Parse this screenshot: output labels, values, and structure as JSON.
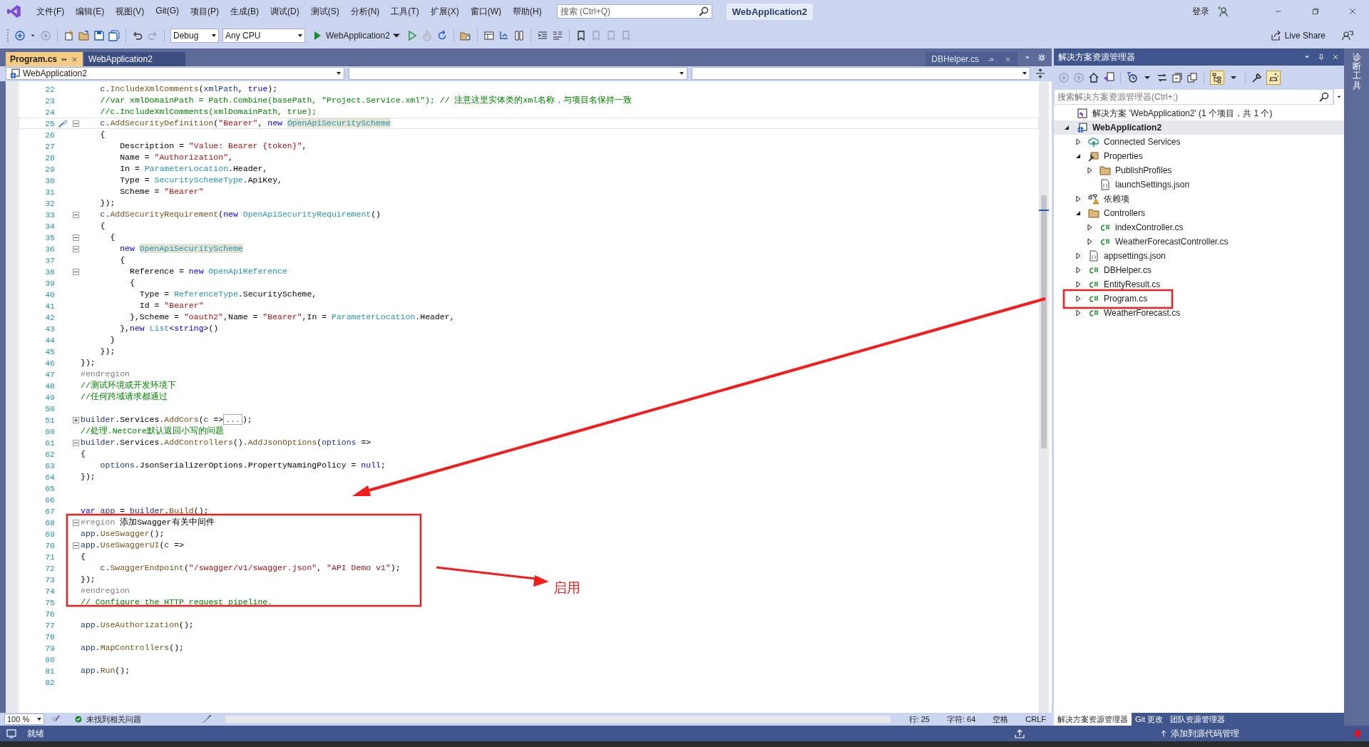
{
  "menu": [
    "文件(F)",
    "编辑(E)",
    "视图(V)",
    "Git(G)",
    "项目(P)",
    "生成(B)",
    "调试(D)",
    "测试(S)",
    "分析(N)",
    "工具(T)",
    "扩展(X)",
    "窗口(W)",
    "帮助(H)"
  ],
  "search": {
    "placeholder": "搜索 (Ctrl+Q)"
  },
  "title": "WebApplication2",
  "account": "登录",
  "toolbar": {
    "configuration": "Debug",
    "platform": "Any CPU",
    "run_target": "WebApplication2",
    "live_share": "Live Share"
  },
  "doc_tabs": [
    {
      "label": "Program.cs",
      "selected": true
    },
    {
      "label": "WebApplication2",
      "selected": false
    }
  ],
  "preview_tab": {
    "label": "DBHelper.cs"
  },
  "nav_bar": {
    "project": "WebApplication2"
  },
  "code_lines": [
    {
      "n": "22",
      "segs": [
        {
          "kind": "vr",
          "text": "    c"
        },
        {
          "kind": "pl",
          "text": "."
        },
        {
          "kind": "mt",
          "text": "IncludeXmlComments"
        },
        {
          "kind": "pl",
          "text": "("
        },
        {
          "kind": "vr",
          "text": "xmlPath"
        },
        {
          "kind": "pl",
          "text": ", "
        },
        {
          "kind": "kw",
          "text": "true"
        },
        {
          "kind": "pl",
          "text": ");"
        }
      ]
    },
    {
      "n": "23",
      "segs": [
        {
          "kind": "cm",
          "text": "    //var xmlDomainPath = Path.Combine(basePath, \"Project.Service.xml\"); // 注意这里实体类的xml名称，与项目名保持一致"
        }
      ]
    },
    {
      "n": "24",
      "segs": [
        {
          "kind": "cm",
          "text": "    //c.IncludeXmlComments(xmlDomainPath, true);"
        }
      ]
    },
    {
      "n": "25",
      "collapsed": false,
      "quick_action": true,
      "current": true,
      "segs": [
        {
          "kind": "vr",
          "text": "    c"
        },
        {
          "kind": "pl",
          "text": "."
        },
        {
          "kind": "mt",
          "text": "AddSecurityDefinition"
        },
        {
          "kind": "pl",
          "text": "("
        },
        {
          "kind": "st",
          "text": "\"Bearer\""
        },
        {
          "kind": "pl",
          "text": ", "
        },
        {
          "kind": "kw",
          "text": "new "
        },
        {
          "kind": "hl",
          "text": "OpenApiSecurityScheme"
        }
      ]
    },
    {
      "n": "26",
      "segs": [
        {
          "kind": "pl",
          "text": "    {"
        }
      ]
    },
    {
      "n": "27",
      "segs": [
        {
          "kind": "pl",
          "text": "        Description = "
        },
        {
          "kind": "st",
          "text": "\"Value: Bearer {token}\""
        },
        {
          "kind": "pl",
          "text": ","
        }
      ]
    },
    {
      "n": "28",
      "segs": [
        {
          "kind": "pl",
          "text": "        Name = "
        },
        {
          "kind": "st",
          "text": "\"Authorization\""
        },
        {
          "kind": "pl",
          "text": ","
        }
      ]
    },
    {
      "n": "29",
      "segs": [
        {
          "kind": "pl",
          "text": "        In = "
        },
        {
          "kind": "ty",
          "text": "ParameterLocation"
        },
        {
          "kind": "pl",
          "text": ".Header,"
        }
      ]
    },
    {
      "n": "30",
      "segs": [
        {
          "kind": "pl",
          "text": "        Type = "
        },
        {
          "kind": "ty",
          "text": "SecuritySchemeType"
        },
        {
          "kind": "pl",
          "text": ".ApiKey,"
        }
      ]
    },
    {
      "n": "31",
      "segs": [
        {
          "kind": "pl",
          "text": "        Scheme = "
        },
        {
          "kind": "st",
          "text": "\"Bearer\""
        }
      ]
    },
    {
      "n": "32",
      "segs": [
        {
          "kind": "pl",
          "text": "    });"
        }
      ]
    },
    {
      "n": "33",
      "collapsed": false,
      "segs": [
        {
          "kind": "vr",
          "text": "    c"
        },
        {
          "kind": "pl",
          "text": "."
        },
        {
          "kind": "mt",
          "text": "AddSecurityRequirement"
        },
        {
          "kind": "pl",
          "text": "("
        },
        {
          "kind": "kw",
          "text": "new "
        },
        {
          "kind": "ty",
          "text": "OpenApiSecurityRequirement"
        },
        {
          "kind": "pl",
          "text": "()"
        }
      ]
    },
    {
      "n": "34",
      "segs": [
        {
          "kind": "pl",
          "text": "    {"
        }
      ]
    },
    {
      "n": "35",
      "collapsed": false,
      "segs": [
        {
          "kind": "pl",
          "text": "      {"
        }
      ]
    },
    {
      "n": "36",
      "collapsed": false,
      "segs": [
        {
          "kind": "kw",
          "text": "        new "
        },
        {
          "kind": "hl",
          "text": "OpenApiSecurityScheme"
        }
      ]
    },
    {
      "n": "37",
      "segs": [
        {
          "kind": "pl",
          "text": "        {"
        }
      ]
    },
    {
      "n": "38",
      "collapsed": false,
      "segs": [
        {
          "kind": "pl",
          "text": "          Reference = "
        },
        {
          "kind": "kw",
          "text": "new "
        },
        {
          "kind": "ty",
          "text": "OpenApiReference"
        }
      ]
    },
    {
      "n": "39",
      "segs": [
        {
          "kind": "pl",
          "text": "          {"
        }
      ]
    },
    {
      "n": "40",
      "segs": [
        {
          "kind": "pl",
          "text": "            Type = "
        },
        {
          "kind": "ty",
          "text": "ReferenceType"
        },
        {
          "kind": "pl",
          "text": ".SecurityScheme,"
        }
      ]
    },
    {
      "n": "41",
      "segs": [
        {
          "kind": "pl",
          "text": "            Id = "
        },
        {
          "kind": "st",
          "text": "\"Bearer\""
        }
      ]
    },
    {
      "n": "42",
      "segs": [
        {
          "kind": "pl",
          "text": "          },Scheme = "
        },
        {
          "kind": "st",
          "text": "\"oauth2\""
        },
        {
          "kind": "pl",
          "text": ",Name = "
        },
        {
          "kind": "st",
          "text": "\"Bearer\""
        },
        {
          "kind": "pl",
          "text": ",In = "
        },
        {
          "kind": "ty",
          "text": "ParameterLocation"
        },
        {
          "kind": "pl",
          "text": ".Header,"
        }
      ]
    },
    {
      "n": "43",
      "segs": [
        {
          "kind": "pl",
          "text": "        },"
        },
        {
          "kind": "kw",
          "text": "new "
        },
        {
          "kind": "ty",
          "text": "List"
        },
        {
          "kind": "pl",
          "text": "<"
        },
        {
          "kind": "kw",
          "text": "string"
        },
        {
          "kind": "pl",
          "text": ">()"
        }
      ]
    },
    {
      "n": "44",
      "segs": [
        {
          "kind": "pl",
          "text": "      }"
        }
      ]
    },
    {
      "n": "45",
      "segs": [
        {
          "kind": "pl",
          "text": "    });"
        }
      ]
    },
    {
      "n": "46",
      "segs": [
        {
          "kind": "pl",
          "text": "});"
        }
      ]
    },
    {
      "n": "47",
      "segs": [
        {
          "kind": "rg",
          "text": "#endregion"
        }
      ]
    },
    {
      "n": "48",
      "segs": [
        {
          "kind": "cm",
          "text": "//测试环境或开发环境下"
        }
      ]
    },
    {
      "n": "49",
      "segs": [
        {
          "kind": "cm",
          "text": "//任何跨域请求都通过"
        }
      ]
    },
    {
      "n": "50"
    },
    {
      "n": "51",
      "collapsed": true,
      "segs": [
        {
          "kind": "vr",
          "text": "builder"
        },
        {
          "kind": "pl",
          "text": ".Services."
        },
        {
          "kind": "mt",
          "text": "AddCors"
        },
        {
          "kind": "pl",
          "text": "("
        },
        {
          "kind": "vr",
          "text": "c"
        },
        {
          "kind": "pl",
          "text": " =>"
        },
        {
          "kind": "collapsed",
          "text": "..."
        },
        {
          "kind": "pl",
          "text": ");"
        }
      ]
    },
    {
      "n": "60",
      "segs": [
        {
          "kind": "cm",
          "text": "//处理.NetCore默认返回小写的问题"
        }
      ]
    },
    {
      "n": "61",
      "collapsed": false,
      "segs": [
        {
          "kind": "vr",
          "text": "builder"
        },
        {
          "kind": "pl",
          "text": ".Services."
        },
        {
          "kind": "mt",
          "text": "AddControllers"
        },
        {
          "kind": "pl",
          "text": "()."
        },
        {
          "kind": "mt",
          "text": "AddJsonOptions"
        },
        {
          "kind": "pl",
          "text": "("
        },
        {
          "kind": "vr",
          "text": "options"
        },
        {
          "kind": "pl",
          "text": " =>"
        }
      ]
    },
    {
      "n": "62",
      "segs": [
        {
          "kind": "pl",
          "text": "{"
        }
      ]
    },
    {
      "n": "63",
      "segs": [
        {
          "kind": "vr",
          "text": "    options"
        },
        {
          "kind": "pl",
          "text": ".JsonSerializerOptions.PropertyNamingPolicy = "
        },
        {
          "kind": "kw",
          "text": "null"
        },
        {
          "kind": "pl",
          "text": ";"
        }
      ]
    },
    {
      "n": "64",
      "segs": [
        {
          "kind": "pl",
          "text": "});"
        }
      ]
    },
    {
      "n": "65"
    },
    {
      "n": "66"
    },
    {
      "n": "67",
      "segs": [
        {
          "kind": "kw",
          "text": "var "
        },
        {
          "kind": "vr",
          "text": "app"
        },
        {
          "kind": "pl",
          "text": " = "
        },
        {
          "kind": "vr",
          "text": "builder"
        },
        {
          "kind": "pl",
          "text": "."
        },
        {
          "kind": "mt",
          "text": "Build"
        },
        {
          "kind": "pl",
          "text": "();"
        }
      ]
    },
    {
      "n": "68",
      "collapsed": false,
      "segs": [
        {
          "kind": "rg",
          "text": "#region"
        },
        {
          "kind": "pl",
          "text": " 添加Swagger有关中间件"
        }
      ]
    },
    {
      "n": "69",
      "segs": [
        {
          "kind": "vr",
          "text": "app"
        },
        {
          "kind": "pl",
          "text": "."
        },
        {
          "kind": "mt",
          "text": "UseSwagger"
        },
        {
          "kind": "pl",
          "text": "();"
        }
      ]
    },
    {
      "n": "70",
      "collapsed": false,
      "segs": [
        {
          "kind": "vr",
          "text": "app"
        },
        {
          "kind": "pl",
          "text": "."
        },
        {
          "kind": "mt",
          "text": "UseSwaggerUI"
        },
        {
          "kind": "pl",
          "text": "("
        },
        {
          "kind": "vr",
          "text": "c"
        },
        {
          "kind": "pl",
          "text": " =>"
        }
      ]
    },
    {
      "n": "71",
      "segs": [
        {
          "kind": "pl",
          "text": "{"
        }
      ]
    },
    {
      "n": "72",
      "segs": [
        {
          "kind": "vr",
          "text": "    c"
        },
        {
          "kind": "pl",
          "text": "."
        },
        {
          "kind": "mt",
          "text": "SwaggerEndpoint"
        },
        {
          "kind": "pl",
          "text": "("
        },
        {
          "kind": "st",
          "text": "\"/swagger/v1/swagger.json\""
        },
        {
          "kind": "pl",
          "text": ", "
        },
        {
          "kind": "st",
          "text": "\"API Demo v1\""
        },
        {
          "kind": "pl",
          "text": ");"
        }
      ]
    },
    {
      "n": "73",
      "segs": [
        {
          "kind": "pl",
          "text": "});"
        }
      ]
    },
    {
      "n": "74",
      "segs": [
        {
          "kind": "rg",
          "text": "#endregion"
        }
      ]
    },
    {
      "n": "75",
      "segs": [
        {
          "kind": "cm",
          "text": "// Configure the HTTP request pipeline."
        }
      ]
    },
    {
      "n": "76"
    },
    {
      "n": "77",
      "segs": [
        {
          "kind": "vr",
          "text": "app"
        },
        {
          "kind": "pl",
          "text": "."
        },
        {
          "kind": "mt",
          "text": "UseAuthorization"
        },
        {
          "kind": "pl",
          "text": "();"
        }
      ]
    },
    {
      "n": "78"
    },
    {
      "n": "79",
      "segs": [
        {
          "kind": "vr",
          "text": "app"
        },
        {
          "kind": "pl",
          "text": "."
        },
        {
          "kind": "mt",
          "text": "MapControllers"
        },
        {
          "kind": "pl",
          "text": "();"
        }
      ]
    },
    {
      "n": "80"
    },
    {
      "n": "81",
      "segs": [
        {
          "kind": "vr",
          "text": "app"
        },
        {
          "kind": "pl",
          "text": "."
        },
        {
          "kind": "mt",
          "text": "Run"
        },
        {
          "kind": "pl",
          "text": "();"
        }
      ]
    },
    {
      "n": "82"
    }
  ],
  "annotation": {
    "label": "启用"
  },
  "editor_status": {
    "zoom": "100 %",
    "issues": "未找到相关问题",
    "line": "行: 25",
    "column": "字符: 64",
    "indent": "空格",
    "line_ending": "CRLF"
  },
  "explorer": {
    "title": "解决方案资源管理器",
    "search": {
      "placeholder": "搜索解决方案资源管理器(Ctrl+;)"
    },
    "solution": "解决方案 'WebApplication2' (1 个项目，共 1 个)",
    "tree": [
      {
        "label": "WebApplication2",
        "kind": "project",
        "expanded": true,
        "selected": true,
        "children": [
          {
            "label": "Connected Services",
            "kind": "connected",
            "expanded": false,
            "selected": false
          },
          {
            "label": "Properties",
            "kind": "properties",
            "expanded": true,
            "selected": false,
            "children": [
              {
                "label": "PublishProfiles",
                "kind": "folder",
                "expanded": false,
                "selected": false
              },
              {
                "label": "launchSettings.json",
                "kind": "json",
                "selected": false
              }
            ]
          },
          {
            "label": "依赖项",
            "kind": "dependencies",
            "expanded": false,
            "selected": false
          },
          {
            "label": "Controllers",
            "kind": "folder",
            "expanded": true,
            "selected": false,
            "children": [
              {
                "label": "indexController.cs",
                "kind": "csharp",
                "expanded": false,
                "selected": false
              },
              {
                "label": "WeatherForecastController.cs",
                "kind": "csharp",
                "expanded": false,
                "selected": false
              }
            ]
          },
          {
            "label": "appsettings.json",
            "kind": "json",
            "expanded": false,
            "selected": false
          },
          {
            "label": "DBHelper.cs",
            "kind": "csharp",
            "expanded": false,
            "selected": false
          },
          {
            "label": "EntityResult.cs",
            "kind": "csharp",
            "expanded": false,
            "selected": false
          },
          {
            "label": "Program.cs",
            "kind": "csharp",
            "expanded": false,
            "selected": false
          },
          {
            "label": "WeatherForecast.cs",
            "kind": "csharp",
            "expanded": false,
            "selected": false
          }
        ]
      }
    ],
    "bottom_tabs": [
      {
        "label": "解决方案资源管理器",
        "selected": true
      },
      {
        "label": "Git 更改",
        "selected": false
      },
      {
        "label": "团队资源管理器",
        "selected": false
      }
    ]
  },
  "side_strip": {
    "label": "诊断工具"
  },
  "status_bar": {
    "message": "就绪",
    "source_control": "添加到源代码管理"
  }
}
